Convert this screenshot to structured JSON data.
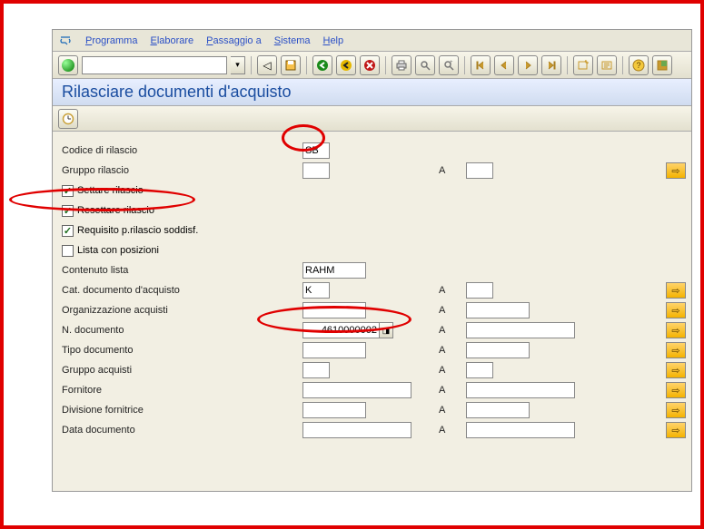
{
  "menu": {
    "programma": "Programma",
    "elaborare": "Elaborare",
    "passaggio": "Passaggio a",
    "sistema": "Sistema",
    "help": "Help"
  },
  "title": "Rilasciare documenti d'acquisto",
  "labels": {
    "codice_rilascio": "Codice di rilascio",
    "gruppo_rilascio": "Gruppo rilascio",
    "settare": "Settare rilascio",
    "resettare": "Resettare rilascio",
    "requisito": "Requisito p.rilascio soddisf.",
    "lista": "Lista con posizioni",
    "contenuto": "Contenuto lista",
    "cat_doc": "Cat. documento d'acquisto",
    "org_acq": "Organizzazione acquisti",
    "n_doc": "N. documento",
    "tipo_doc": "Tipo documento",
    "gruppo_acq": "Gruppo acquisti",
    "fornitore": "Fornitore",
    "div_forn": "Divisione fornitrice",
    "data_doc": "Data documento",
    "to": "A"
  },
  "values": {
    "codice_rilascio": "SB",
    "gruppo_rilascio": "",
    "gruppo_rilascio_to": "",
    "contenuto": "RAHM",
    "cat_doc": "K",
    "cat_doc_to": "",
    "org_acq": "",
    "org_acq_to": "",
    "n_doc": "4610000002",
    "n_doc_to": "",
    "tipo_doc": "",
    "tipo_doc_to": "",
    "gruppo_acq": "",
    "gruppo_acq_to": "",
    "fornitore": "",
    "fornitore_to": "",
    "div_forn": "",
    "div_forn_to": "",
    "data_doc": "",
    "data_doc_to": ""
  },
  "checks": {
    "settare": true,
    "resettare": true,
    "requisito": true,
    "lista": false
  }
}
